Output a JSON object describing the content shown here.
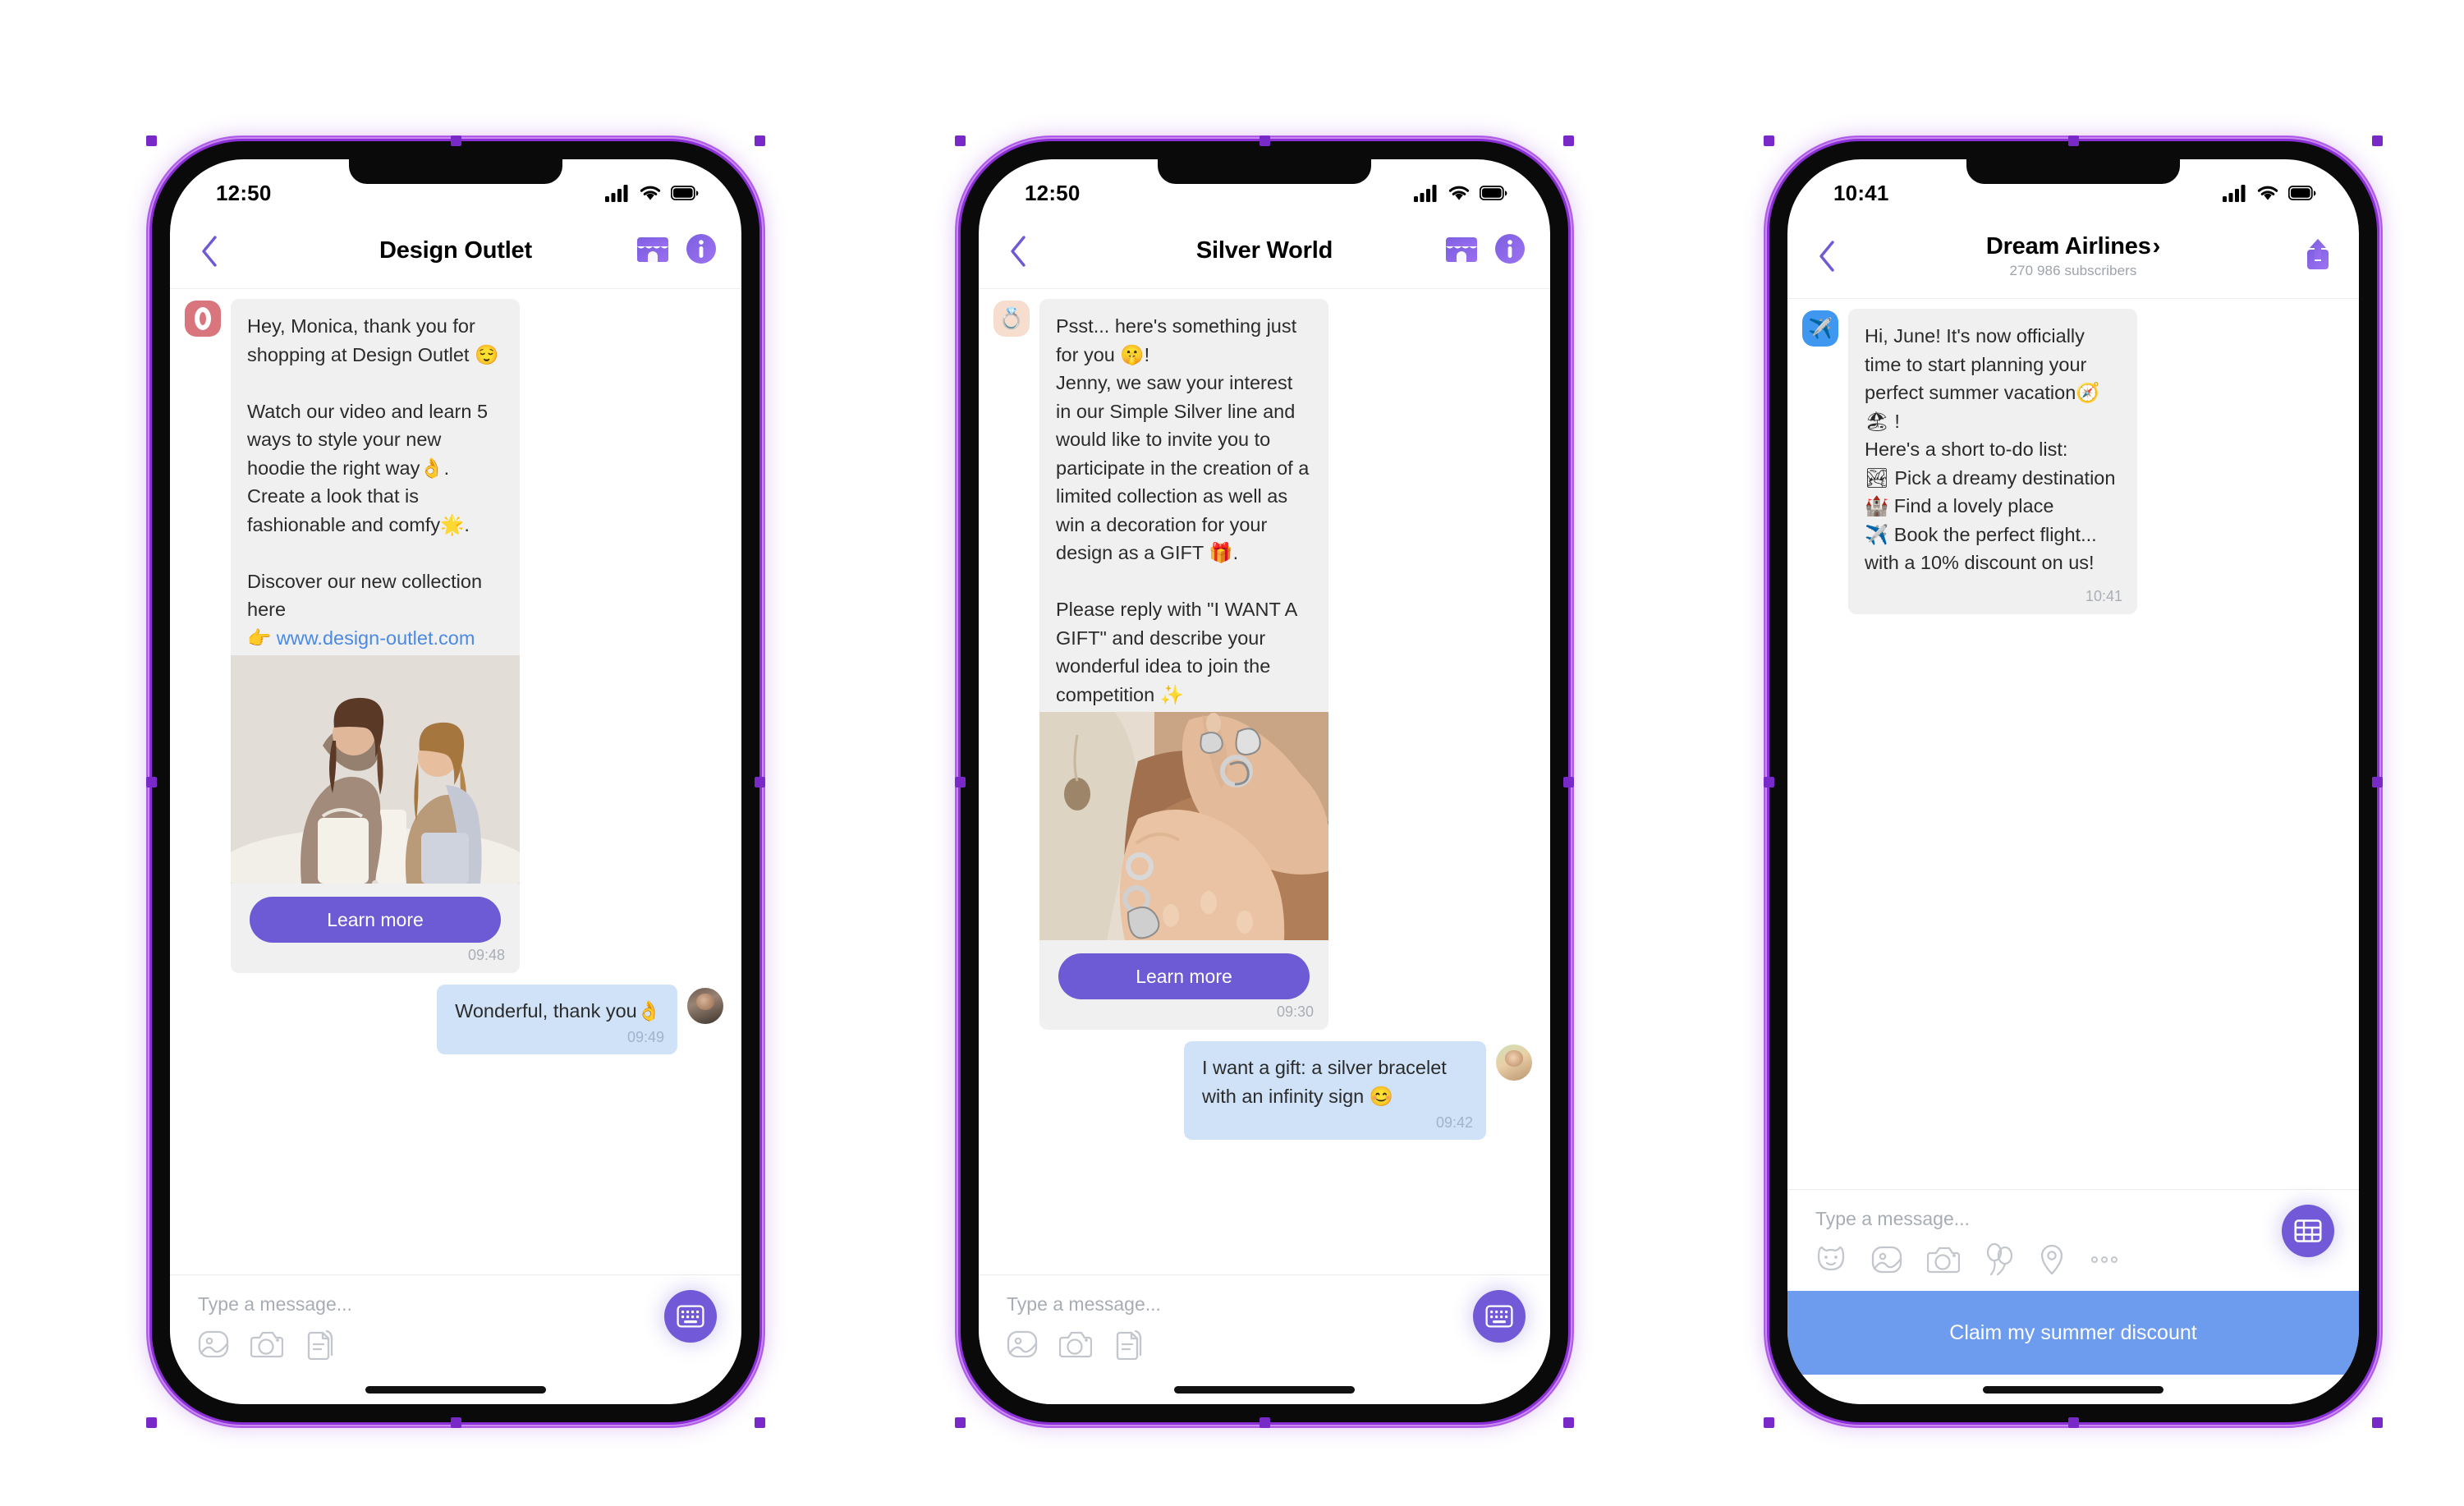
{
  "phones": [
    {
      "id": "design-outlet",
      "status": {
        "time": "12:50"
      },
      "nav": {
        "title": "Design Outlet",
        "subtitle": ""
      },
      "messages": [
        {
          "direction": "in",
          "avatar_icon": "design-outlet-logo",
          "text": "Hey, Monica, thank you for shopping at Design Outlet 😌\n\nWatch our video and learn 5 ways to style your new hoodie the right way👌. Create a look that is fashionable and comfy🌟.\n\nDiscover our new collection here\n👉 ",
          "link": "www.design-outlet.com",
          "image": "two-women-in-beige-hoodies",
          "cta_label": "Learn more",
          "time": "09:48"
        },
        {
          "direction": "out",
          "avatar_icon": "user-photo-monica",
          "text": "Wonderful, thank you👌",
          "time": "09:49"
        }
      ],
      "composer": {
        "placeholder": "Type a message...",
        "icons": [
          "gallery-icon",
          "camera-icon",
          "document-icon"
        ],
        "action_button": "keyboard-icon"
      }
    },
    {
      "id": "silver-world",
      "status": {
        "time": "12:50"
      },
      "nav": {
        "title": "Silver World",
        "subtitle": ""
      },
      "messages": [
        {
          "direction": "in",
          "avatar_icon": "ring-emoji",
          "text": "Psst... here's something just for you 🤫!\nJenny, we saw your interest in our Simple Silver line and would like to invite you to participate in the creation of a limited collection as well as win a decoration for your design as a GIFT 🎁.\n\nPlease reply with \"I WANT A GIFT\" and describe your wonderful idea to join the competition ✨",
          "image": "hands-with-silver-rings",
          "cta_label": "Learn more",
          "time": "09:30"
        },
        {
          "direction": "out",
          "avatar_icon": "user-photo-jenny",
          "text": "I want a gift: a silver bracelet with an infinity sign 😊",
          "time": "09:42"
        }
      ],
      "composer": {
        "placeholder": "Type a message...",
        "icons": [
          "gallery-icon",
          "camera-icon",
          "document-icon"
        ],
        "action_button": "keyboard-icon"
      }
    },
    {
      "id": "dream-airlines",
      "status": {
        "time": "10:41"
      },
      "nav": {
        "title": "Dream Airlines",
        "chevron": "›",
        "subtitle": "270 986 subscribers"
      },
      "messages": [
        {
          "direction": "in",
          "avatar_icon": "airplane-emoji",
          "text": "Hi, June! It's now officially time to start planning your perfect summer vacation🧭🏖 !\nHere's a short to-do list:\n🏞 Pick a dreamy destination\n🏰 Find a lovely place\n✈️ Book the perfect flight...\nwith a 10% discount on us!",
          "time": "10:41"
        }
      ],
      "composer": {
        "placeholder": "Type a message...",
        "icons": [
          "sticker-icon",
          "gallery-icon",
          "camera-icon",
          "balloons-icon",
          "location-icon",
          "more-icon"
        ],
        "action_button": "grid-keyboard-icon"
      },
      "bottom_cta": "Claim my summer discount"
    }
  ],
  "colors": {
    "accent_purple": "#6c5bd4",
    "kbd_purple": "#7159d8",
    "link_blue": "#4a8ae4",
    "out_bubble": "#cfe2f8",
    "in_bubble": "#f0f0f0",
    "cta_blue": "#6d9bee",
    "frame_purple": "#8b2fd6"
  }
}
